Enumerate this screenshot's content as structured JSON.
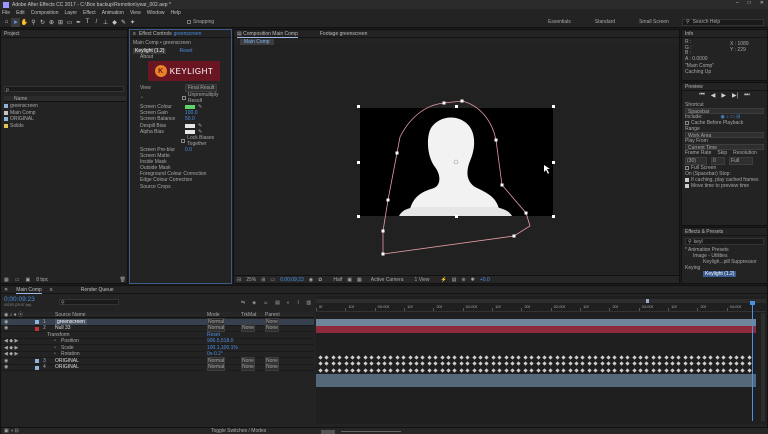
{
  "window": {
    "title": "Adobe After Effects CC 2017 - C:\\Box backup\\Remotion\\year_002.aep *",
    "controls": [
      "–",
      "□",
      "✕"
    ]
  },
  "menu": [
    "File",
    "Edit",
    "Composition",
    "Layer",
    "Effect",
    "Animation",
    "View",
    "Window",
    "Help"
  ],
  "toolbar": {
    "snapping": "Snapping",
    "workspaces": [
      "Essentials",
      "Standard",
      "Small Screen"
    ],
    "search_placeholder": "Search Help"
  },
  "project": {
    "tab": "Project",
    "search_placeholder": "ρ",
    "col_name": "Name",
    "items": [
      {
        "name": "greenscreen",
        "color": "#8fb3d9"
      },
      {
        "name": "Main Comp",
        "color": "#c5c5c5"
      },
      {
        "name": "ORIGINAL",
        "color": "#8fb3d9"
      },
      {
        "name": "Solids",
        "color": "#e3c25a"
      }
    ],
    "footer": {
      "bpc": "8 bpc"
    }
  },
  "effect_controls": {
    "tab": "Effect Controls",
    "layer": "greenscreen",
    "header": "Main Comp • greenscreen",
    "effect_name": "Keylight (1.2)",
    "reset": "Reset",
    "about": "About",
    "logo_text": "KEYLIGHT",
    "props": [
      {
        "label": "View",
        "value": "Final Result"
      },
      {
        "label": "",
        "value": "Unpremultiply Result",
        "checkbox": true
      },
      {
        "label": "Screen Colour",
        "value": ""
      },
      {
        "label": "Screen Gain",
        "value": "100.0"
      },
      {
        "label": "Screen Balance",
        "value": "50.0"
      },
      {
        "label": "Despill Bias",
        "value": ""
      },
      {
        "label": "Alpha Bias",
        "value": ""
      },
      {
        "label": "",
        "value": "Lock Biases Together",
        "checkbox": true
      },
      {
        "label": "Screen Pre-blur",
        "value": "0.0"
      },
      {
        "label": "Screen Matte",
        "value": ""
      },
      {
        "label": "Inside Mask",
        "value": ""
      },
      {
        "label": "Outside Mask",
        "value": ""
      },
      {
        "label": "Foreground Colour Correction",
        "value": ""
      },
      {
        "label": "Edge Colour Correction",
        "value": ""
      },
      {
        "label": "Source Crops",
        "value": ""
      }
    ]
  },
  "viewer": {
    "tabs": [
      "Composition Main Comp",
      "Footage greenscreen"
    ],
    "sub_tab": "Main Comp",
    "bottom": {
      "zoom": "25%",
      "timecode": "0;00;09;23",
      "resolution": "Half",
      "camera": "Active Camera",
      "views": "1 View",
      "offset": "+0.0"
    }
  },
  "info": {
    "tab": "Info",
    "r": "R :",
    "g": "G :",
    "b": "B :",
    "a": "A : 0.0000",
    "x": "X : 1089",
    "y": "Y : 229",
    "comp_name": "\"Main Comp\"",
    "status": "Caching Up"
  },
  "preview": {
    "tab": "Preview",
    "shortcut_label": "Shortcut",
    "shortcut": "Spacebar",
    "include_label": "Include:",
    "cache_before": "Cache Before Playback",
    "range_label": "Range",
    "range": "Work Area",
    "play_from_label": "Play From",
    "play_from": "Current Time",
    "frame_rate_label": "Frame Rate",
    "frame_rate": "(30)",
    "skip_label": "Skip",
    "skip": "0",
    "resolution_label": "Resolution",
    "resolution": "Full",
    "fullscreen": "Full Screen",
    "on_stop": "On (Spacebar) Stop:",
    "if_caching": "If caching, play cached frames",
    "move_time": "Move time to preview time"
  },
  "effects_presets": {
    "tab": "Effects & Presets",
    "search": "keyl",
    "tree": [
      "* Animation Presets",
      "Image - Utilities",
      "Keyligh...pill Suppressor",
      "Keying",
      "Keylight (1.2)"
    ]
  },
  "timeline": {
    "tab": "Main Comp",
    "render_queue": "Render Queue",
    "timecode": "0;00:09:23",
    "fps_info": "00293 (29.97 fps)",
    "columns": {
      "source": "Source Name",
      "mode": "Mode",
      "trkmat": "TrkMat",
      "parent": "Parent"
    },
    "layers": [
      {
        "num": "1",
        "name": "greenscreen",
        "mode": "Normal",
        "trkmat": "",
        "parent": "None",
        "color": "#8fb3d9"
      },
      {
        "num": "2",
        "name": "Null 33",
        "mode": "Normal",
        "trkmat": "None",
        "parent": "None",
        "color": "#c0303d"
      },
      {
        "num": "",
        "name": "Transform",
        "mode": "Reset",
        "trkmat": "",
        "parent": "",
        "color": ""
      },
      {
        "num": "",
        "name": "Position",
        "mode": "906.5,518.0",
        "trkmat": "",
        "parent": "",
        "color": ""
      },
      {
        "num": "",
        "name": "Scale",
        "mode": "100.1,100.1%",
        "trkmat": "",
        "parent": "",
        "color": ""
      },
      {
        "num": "",
        "name": "Rotation",
        "mode": "0x-0.2°",
        "trkmat": "",
        "parent": "",
        "color": ""
      },
      {
        "num": "3",
        "name": "ORIGINAL",
        "mode": "Normal",
        "trkmat": "None",
        "parent": "None",
        "color": "#8fb3d9"
      },
      {
        "num": "4",
        "name": "ORIGINAL",
        "mode": "Normal",
        "trkmat": "None",
        "parent": "None",
        "color": "#8fb3d9"
      }
    ],
    "ruler": [
      "0f",
      "10f",
      "00:00f",
      "10f",
      "20f",
      "01:00f",
      "10f",
      "20f",
      "02:00f",
      "10f",
      "20f",
      "03:00f",
      "10f",
      "20f",
      "04:00f"
    ],
    "footer": "Toggle Switches / Modes"
  }
}
